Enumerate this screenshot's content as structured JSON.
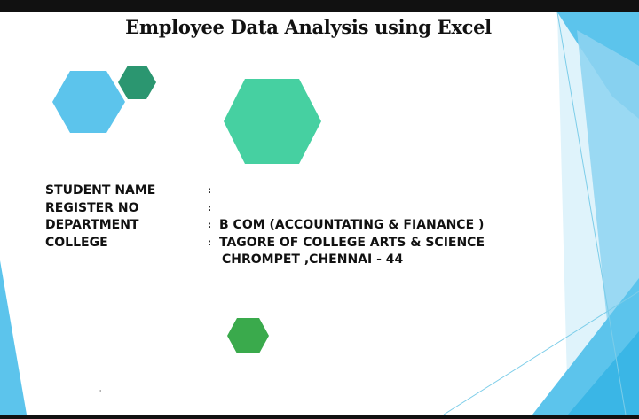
{
  "slide": {
    "title": "Employee Data Analysis using Excel",
    "fields": [
      {
        "label": "STUDENT NAME",
        "colon": ":",
        "value": ""
      },
      {
        "label": "REGISTER NO",
        "colon": ":",
        "value": ""
      },
      {
        "label": "DEPARTMENT",
        "colon": ":",
        "value": "B COM (ACCOUNTATING  & FIANANCE )"
      },
      {
        "label": "COLLEGE",
        "colon": ":",
        "value": "TAGORE OF COLLEGE ARTS & SCIENCE"
      }
    ],
    "college_line2": "CHROMPET ,CHENNAI - 44",
    "stray_mark": "'"
  },
  "colors": {
    "hex_light_blue": "#5cc4ec",
    "hex_dark_green": "#2b9670",
    "hex_mint": "#46d0a1",
    "hex_green": "#3aaa4c",
    "right_panel_blue": "#5cc4ec",
    "right_panel_light": "#aadff5"
  },
  "icons": [
    "hexagon-shape"
  ]
}
